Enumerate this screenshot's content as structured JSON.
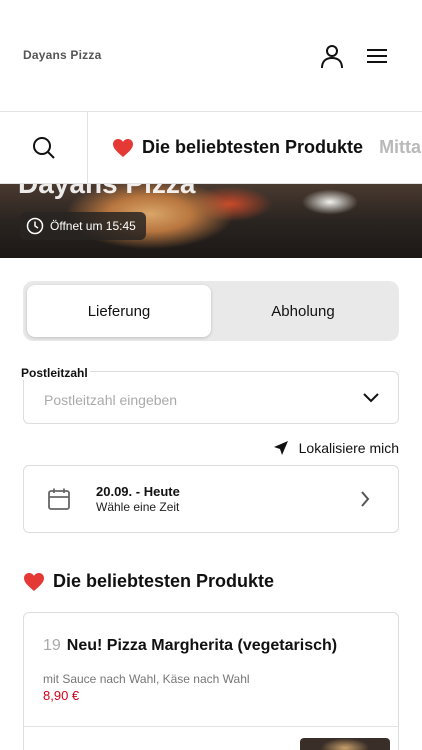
{
  "header": {
    "brand": "Dayans Pizza"
  },
  "category_bar": {
    "active_label": "Die beliebtesten Produkte",
    "next_label": "Mitta"
  },
  "hero": {
    "title": "Dayans Pizza",
    "open_hours": "Öffnet um 15:45"
  },
  "order_mode": {
    "delivery": "Lieferung",
    "pickup": "Abholung",
    "selected": "Lieferung"
  },
  "zip": {
    "label": "Postleitzahl",
    "placeholder": "Postleitzahl eingeben"
  },
  "locate": {
    "label": "Lokalisiere mich"
  },
  "date": {
    "main": "20.09. - Heute",
    "sub": "Wähle eine Zeit"
  },
  "section": {
    "title": "Die beliebtesten Produkte"
  },
  "products": [
    {
      "number": "19",
      "name": "Neu! Pizza Margherita (vegetarisch)",
      "description": "mit Sauce nach Wahl, Käse nach Wahl",
      "price": "8,90 €"
    }
  ],
  "colors": {
    "accent_red": "#d0021b",
    "heart": "#e53935",
    "toggle_bg": "#e9e9e9"
  }
}
